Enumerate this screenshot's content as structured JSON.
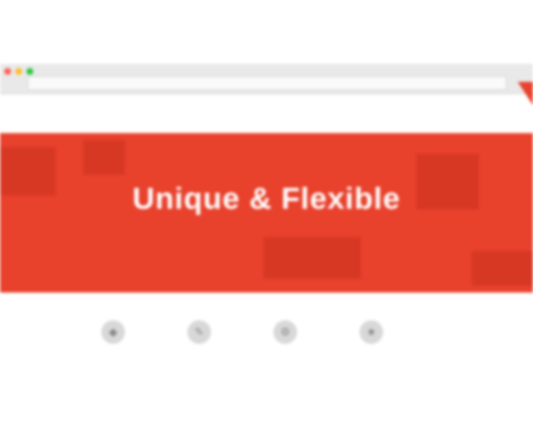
{
  "browser": {
    "url": "",
    "dots": [
      "#ff5f57",
      "#ffbd2e",
      "#28c940"
    ]
  },
  "site": {
    "logo_main": "",
    "logo_accent": "",
    "tagline_left": "",
    "tagline_right": "",
    "nav_items": [
      "",
      "",
      "",
      "",
      "",
      ""
    ],
    "nav_cta": ""
  },
  "hero": {
    "title": "Unique & Flexible",
    "text": "",
    "background": "#e8412c"
  },
  "features": [
    {
      "icon": "diamond-icon",
      "glyph": "◆",
      "title": "",
      "text": ""
    },
    {
      "icon": "pen-icon",
      "glyph": "✎",
      "title": "",
      "text": ""
    },
    {
      "icon": "gear-icon",
      "glyph": "⚙",
      "title": "",
      "text": ""
    },
    {
      "icon": "star-icon",
      "glyph": "★",
      "title": "",
      "text": ""
    }
  ],
  "footer": {
    "left_heading": "",
    "right_text": ""
  }
}
